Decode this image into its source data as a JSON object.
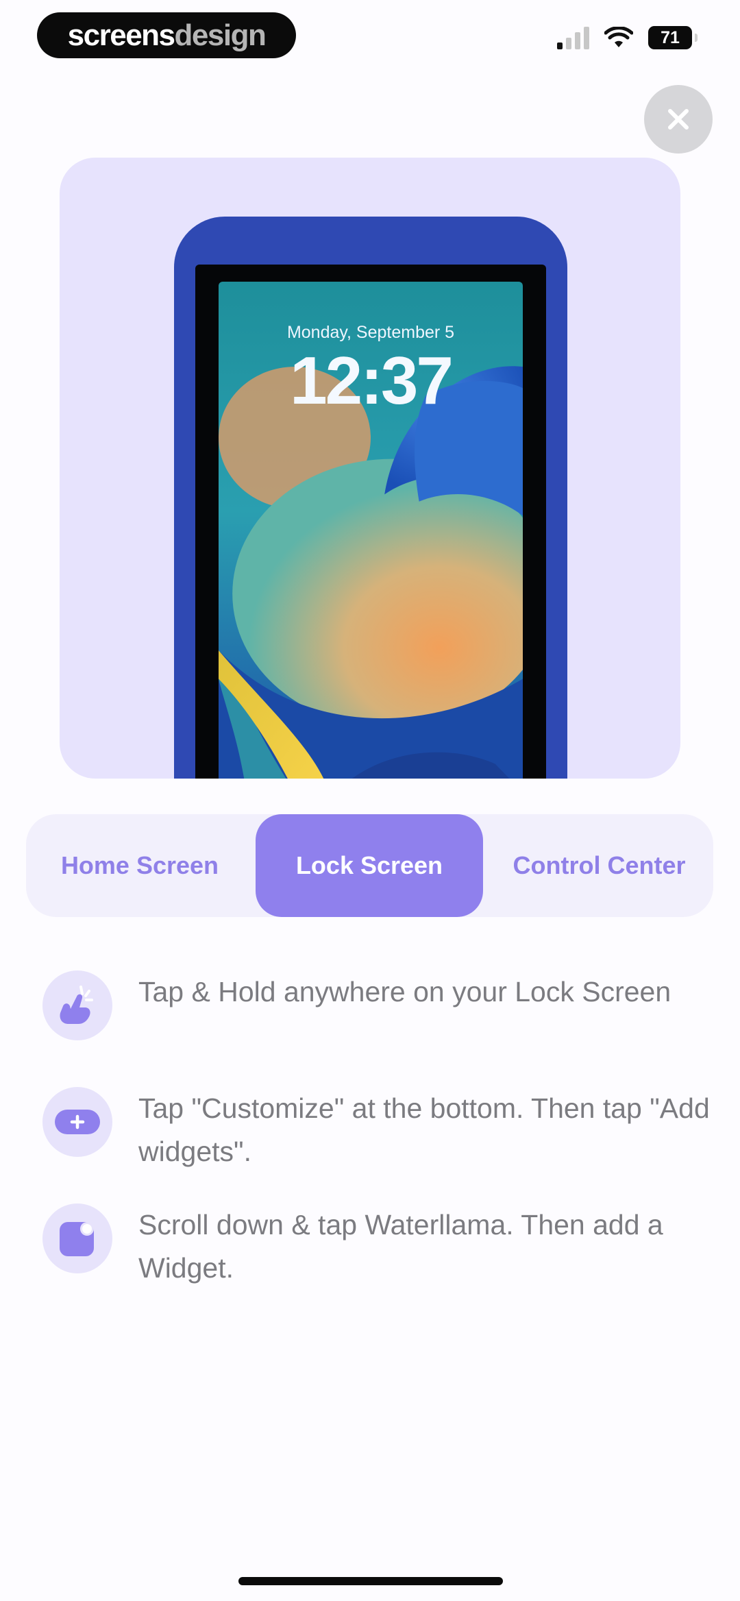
{
  "brand": {
    "part1": "screens",
    "part2": "design"
  },
  "status_bar": {
    "battery": "71"
  },
  "preview": {
    "date": "Monday, September 5",
    "time": "12:37"
  },
  "tabs": [
    {
      "label": "Home Screen",
      "selected": false
    },
    {
      "label": "Lock Screen",
      "selected": true
    },
    {
      "label": "Control Center",
      "selected": false
    }
  ],
  "steps": [
    {
      "icon": "tap-hold-hand-icon",
      "text": "Tap & Hold anywhere on your Lock Screen"
    },
    {
      "icon": "add-plus-icon",
      "text": "Tap \"Customize\" at the bottom. Then tap \"Add widgets\"."
    },
    {
      "icon": "widget-icon",
      "text": "Scroll down & tap Waterllama. Then add a Widget."
    }
  ],
  "colors": {
    "accent": "#8f80ed",
    "panel": "#e7e3fd",
    "device": "#2f49b3"
  }
}
